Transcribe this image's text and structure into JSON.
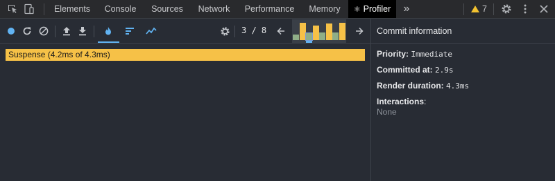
{
  "devtools": {
    "tabs": [
      {
        "label": "Elements",
        "active": false
      },
      {
        "label": "Console",
        "active": false
      },
      {
        "label": "Sources",
        "active": false
      },
      {
        "label": "Network",
        "active": false
      },
      {
        "label": "Performance",
        "active": false
      },
      {
        "label": "Memory",
        "active": false
      },
      {
        "label": "Profiler",
        "active": true
      }
    ],
    "overflow_label": "»",
    "warnings_count": "7",
    "colors": {
      "bar": "#292a2d",
      "active_tab": "#000000",
      "warning": "#f2c230"
    }
  },
  "profiler": {
    "commit_position": "3 / 8",
    "commits": [
      {
        "height_fraction": 0.32,
        "color": "#8fae87"
      },
      {
        "height_fraction": 0.95,
        "color": "#f6c147"
      },
      {
        "height_fraction": 0.38,
        "color": "#8fae87",
        "selected": true
      },
      {
        "height_fraction": 0.82,
        "color": "#f6c147"
      },
      {
        "height_fraction": 0.42,
        "color": "#8fae87"
      },
      {
        "height_fraction": 0.92,
        "color": "#f6c147"
      },
      {
        "height_fraction": 0.44,
        "color": "#8fae87"
      },
      {
        "height_fraction": 0.98,
        "color": "#f6c147"
      }
    ],
    "flame_bar_label": "Suspense (4.2ms of 4.3ms)",
    "colors": {
      "flame": "#f6c147",
      "accent": "#61b3f2",
      "background": "#282c34"
    }
  },
  "commit_info": {
    "title": "Commit information",
    "priority_label": "Priority",
    "priority_value": "Immediate",
    "committed_label": "Committed at",
    "committed_value": "2.9s",
    "duration_label": "Render duration",
    "duration_value": "4.3ms",
    "interactions_label": "Interactions",
    "interactions_value": "None"
  }
}
